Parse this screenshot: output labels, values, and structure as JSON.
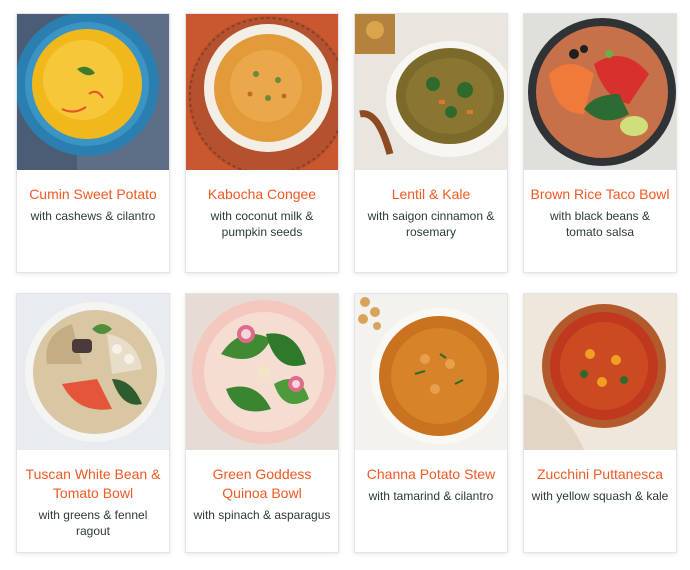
{
  "recipes": [
    {
      "title": "Cumin Sweet Potato",
      "subtitle": "with cashews & cilantro",
      "photo_icon": "curry-soup-photo-icon"
    },
    {
      "title": "Kabocha Congee",
      "subtitle": "with coconut milk & pumpkin seeds",
      "photo_icon": "congee-bowl-photo-icon"
    },
    {
      "title": "Lentil & Kale",
      "subtitle": "with saigon cinnamon & rosemary",
      "photo_icon": "lentil-soup-photo-icon"
    },
    {
      "title": "Brown Rice Taco Bowl",
      "subtitle": "with black beans & tomato salsa",
      "photo_icon": "taco-bowl-photo-icon"
    },
    {
      "title": "Tuscan White Bean & Tomato Bowl",
      "subtitle": "with greens & fennel ragout",
      "photo_icon": "bean-bowl-photo-icon"
    },
    {
      "title": "Green Goddess Quinoa Bowl",
      "subtitle": "with spinach & asparagus",
      "photo_icon": "salad-bowl-photo-icon"
    },
    {
      "title": "Channa Potato Stew",
      "subtitle": "with tamarind & cilantro",
      "photo_icon": "stew-bowl-photo-icon"
    },
    {
      "title": "Zucchini Puttanesca",
      "subtitle": "with yellow squash & kale",
      "photo_icon": "tomato-stew-photo-icon"
    }
  ],
  "colors": {
    "title": "#f05a23",
    "subtitle": "#2e3a3a"
  }
}
